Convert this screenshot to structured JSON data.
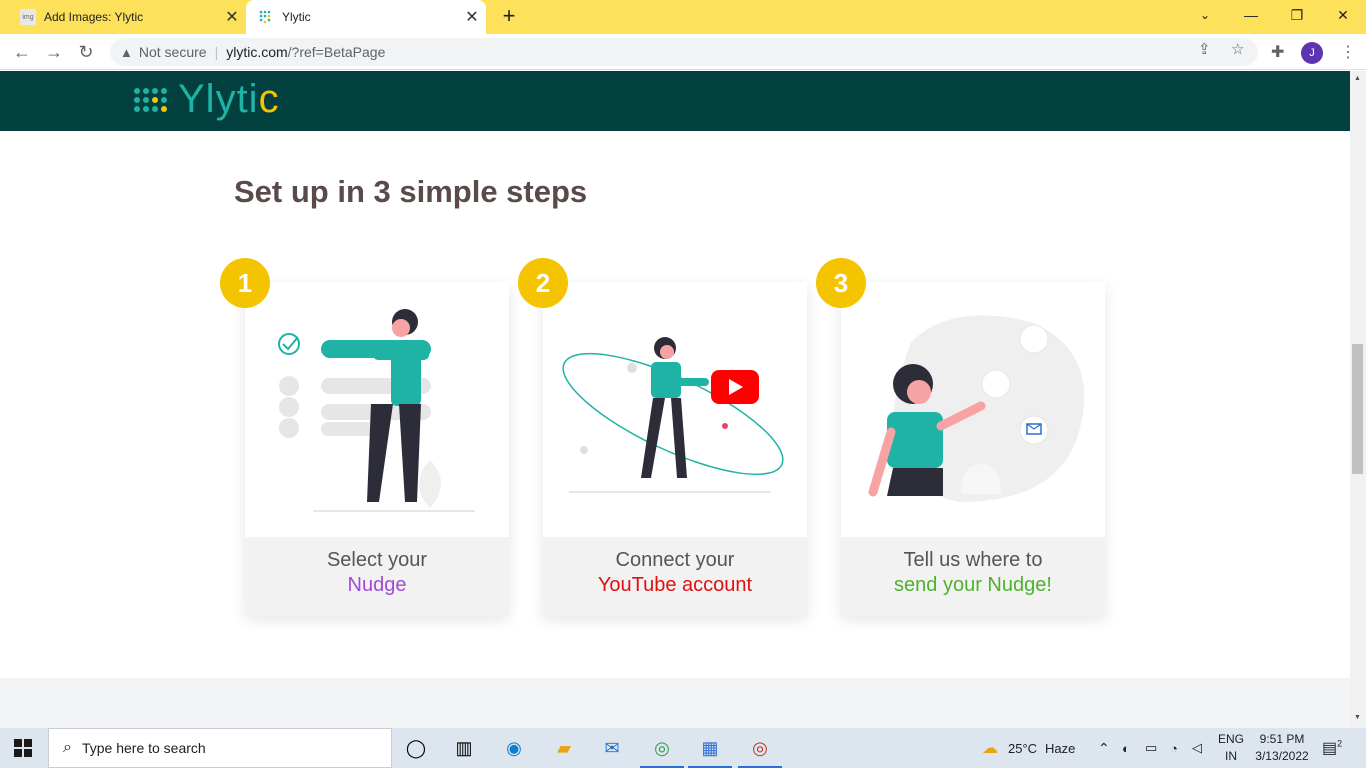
{
  "browser": {
    "tabs": [
      {
        "title": "Add Images: Ylytic",
        "favicon": "tmp-favicon",
        "active": false
      },
      {
        "title": "Ylytic",
        "favicon": "ylytic-favicon",
        "active": true
      }
    ],
    "new_tab_icon": "+",
    "security_label": "Not secure",
    "url_host": "ylytic.com",
    "url_path": "/?ref=BetaPage",
    "profile_initial": "J"
  },
  "page": {
    "logo_text_main": "Ylyti",
    "logo_text_accent": "c",
    "section_title": "Set up in 3 simple steps",
    "steps": [
      {
        "number": "1",
        "line1": "Select your",
        "line2": "Nudge",
        "accent": "#a349d6"
      },
      {
        "number": "2",
        "line1": "Connect your",
        "line2": "YouTube account",
        "accent": "#e01010"
      },
      {
        "number": "3",
        "line1": "Tell us where to",
        "line2": "send your Nudge!",
        "accent": "#4fb22c"
      }
    ],
    "colors": {
      "header": "#01403f",
      "brand": "#1fb3a6",
      "badge": "#f5c400"
    }
  },
  "taskbar": {
    "search_placeholder": "Type here to search",
    "weather_temp": "25°C",
    "weather_desc": "Haze",
    "lang_line1": "ENG",
    "lang_line2": "IN",
    "time": "9:51 PM",
    "date": "3/13/2022",
    "notification_count": "2"
  }
}
